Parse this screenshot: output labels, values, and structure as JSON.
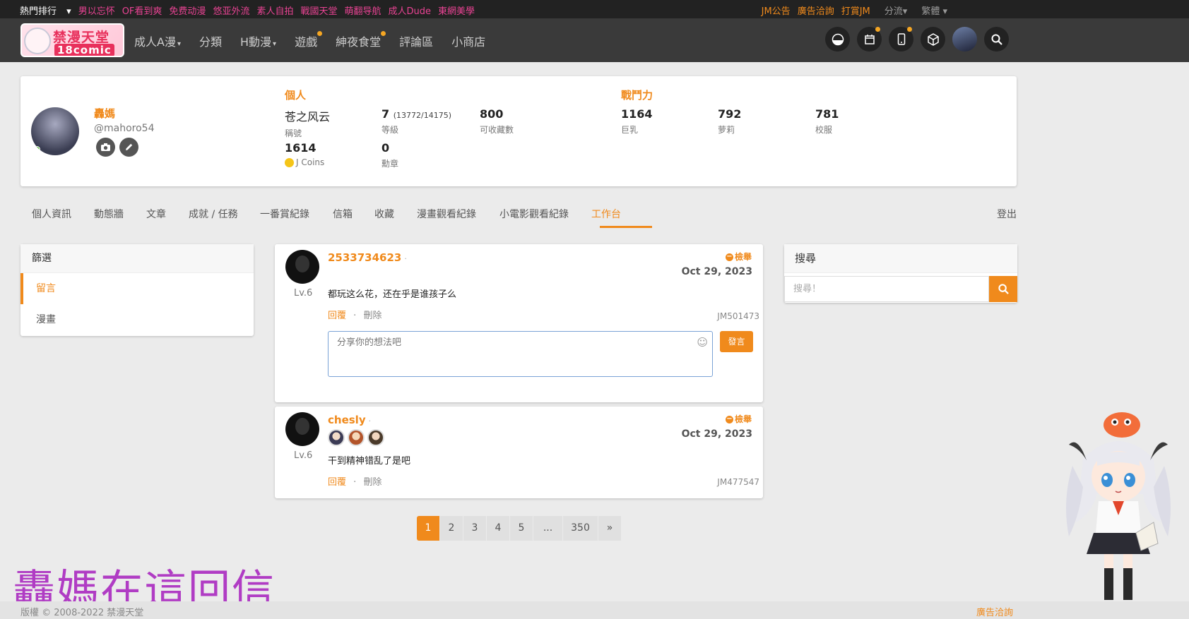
{
  "topbar": {
    "hot": "熱門排行",
    "links": [
      "男以忘怀",
      "OF看到爽",
      "免费动漫",
      "悠亚外流",
      "素人自拍",
      "戰國天堂",
      "萌翻导航",
      "成人Dude",
      "東網美學"
    ],
    "right": [
      {
        "label": "JM公告",
        "tone": "orange"
      },
      {
        "label": "廣告洽詢",
        "tone": "orange"
      },
      {
        "label": "打賞JM",
        "tone": "orange"
      },
      {
        "label": "分流",
        "tone": "gray"
      },
      {
        "label": "繁體",
        "tone": "gray"
      }
    ]
  },
  "logo": {
    "title": "禁漫天堂",
    "sub": "18comic"
  },
  "nav": {
    "items": [
      {
        "label": "成人A漫",
        "caret": true
      },
      {
        "label": "分類"
      },
      {
        "label": "H動漫",
        "caret": true
      },
      {
        "label": "遊戲",
        "dot": true
      },
      {
        "label": "紳夜食堂",
        "dot": true
      },
      {
        "label": "評論區"
      },
      {
        "label": "小商店"
      }
    ],
    "icons": [
      "theme-icon",
      "calendar-icon",
      "mobile-icon",
      "dice-icon",
      "user-avatar",
      "search-icon"
    ]
  },
  "profile": {
    "name": "轟媽",
    "handle": "@mahoro54",
    "personal_title": "個人",
    "power_title": "戰鬥力",
    "stats": {
      "title_value": "苍之风云",
      "title_key": "稱號",
      "level_value": "7",
      "level_progress": "(13772/14175)",
      "level_key": "等級",
      "fav_value": "800",
      "fav_key": "可收藏數",
      "coins_value": "1614",
      "coins_key": "J Coins",
      "medal_value": "0",
      "medal_key": "勳章",
      "p1_value": "1164",
      "p1_key": "巨乳",
      "p2_value": "792",
      "p2_key": "萝莉",
      "p3_value": "781",
      "p3_key": "校服"
    }
  },
  "tabs": [
    "個人資訊",
    "動態牆",
    "文章",
    "成就 / 任務",
    "一番賞紀錄",
    "信箱",
    "收藏",
    "漫畫觀看紀錄",
    "小電影觀看紀錄",
    "工作台"
  ],
  "tabs_active": "工作台",
  "logout": "登出",
  "filter": {
    "title": "篩選",
    "items": [
      "留言",
      "漫畫"
    ],
    "active": "留言"
  },
  "search": {
    "title": "搜尋",
    "placeholder": "搜尋！"
  },
  "comments": [
    {
      "user": "2533734623",
      "level": "Lv.6",
      "report": "檢舉",
      "date": "Oct 29, 2023",
      "text": "都玩这么花，还在乎是谁孩子么",
      "reply": "回覆",
      "sep": "·",
      "delete": "刪除",
      "id": "JM501473",
      "reply_placeholder": "分享你的想法吧",
      "send": "發言"
    },
    {
      "user": "chesly",
      "level": "Lv.6",
      "report": "檢舉",
      "date": "Oct 29, 2023",
      "text": "干到精神错乱了是吧",
      "reply": "回覆",
      "sep": "·",
      "delete": "刪除",
      "id": "JM477547"
    }
  ],
  "pagination": [
    "1",
    "2",
    "3",
    "4",
    "5",
    "...",
    "350",
    "»"
  ],
  "overlay_text": "轟媽在這回信",
  "footer": {
    "copyright": "版權 © 2008-2022 禁漫天堂",
    "ad": "廣告洽詢"
  },
  "colors": {
    "accent": "#f08a1c",
    "topbar_link": "#e84393",
    "nav_bg": "#3a3a3a",
    "overlay": "#b03cc4"
  }
}
